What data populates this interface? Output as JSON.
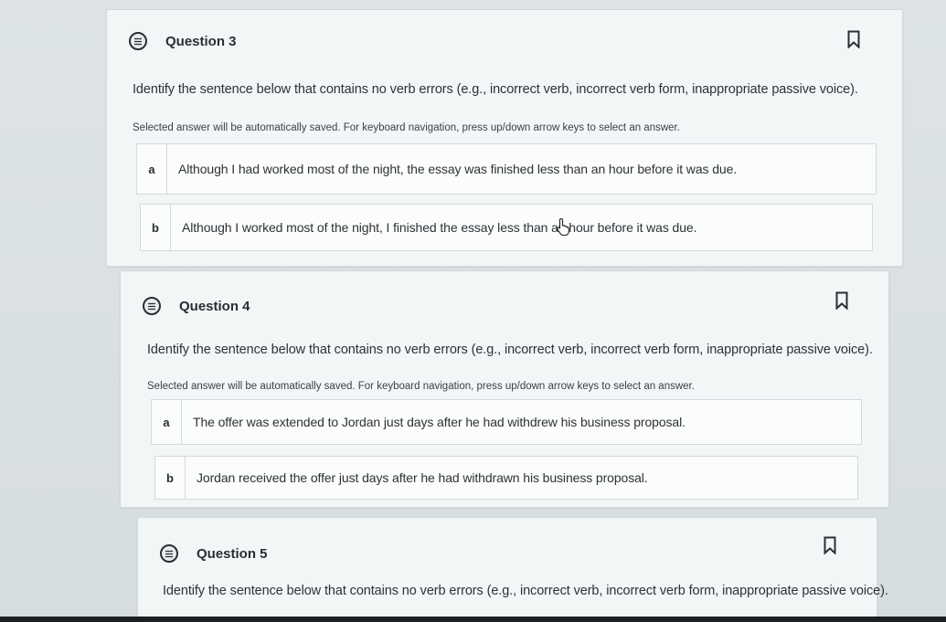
{
  "questions": [
    {
      "title": "Question 3",
      "prompt": "Identify the sentence below that contains no verb errors (e.g., incorrect verb, incorrect verb form, inappropriate passive voice).",
      "hint": "Selected answer will be automatically saved. For keyboard navigation, press up/down arrow keys to select an answer.",
      "options": [
        {
          "letter": "a",
          "text": "Although I had worked most of the night, the essay was finished less than an hour before it was due."
        },
        {
          "letter": "b",
          "text": "Although I worked most of the night, I finished the essay less than an hour before it was due."
        }
      ]
    },
    {
      "title": "Question 4",
      "prompt": "Identify the sentence below that contains no verb errors (e.g., incorrect verb, incorrect verb form, inappropriate passive voice).",
      "hint": "Selected answer will be automatically saved. For keyboard navigation, press up/down arrow keys to select an answer.",
      "options": [
        {
          "letter": "a",
          "text": "The offer was extended to Jordan just days after he had withdrew his business proposal."
        },
        {
          "letter": "b",
          "text": "Jordan received the offer just days after he had withdrawn his business proposal."
        }
      ]
    },
    {
      "title": "Question 5",
      "prompt": "Identify the sentence below that contains no verb errors (e.g., incorrect verb, incorrect verb form, inappropriate passive voice)."
    }
  ],
  "icons": {
    "question": "question-list-icon",
    "bookmark": "bookmark-icon",
    "cursor": "hand-pointer-icon"
  }
}
